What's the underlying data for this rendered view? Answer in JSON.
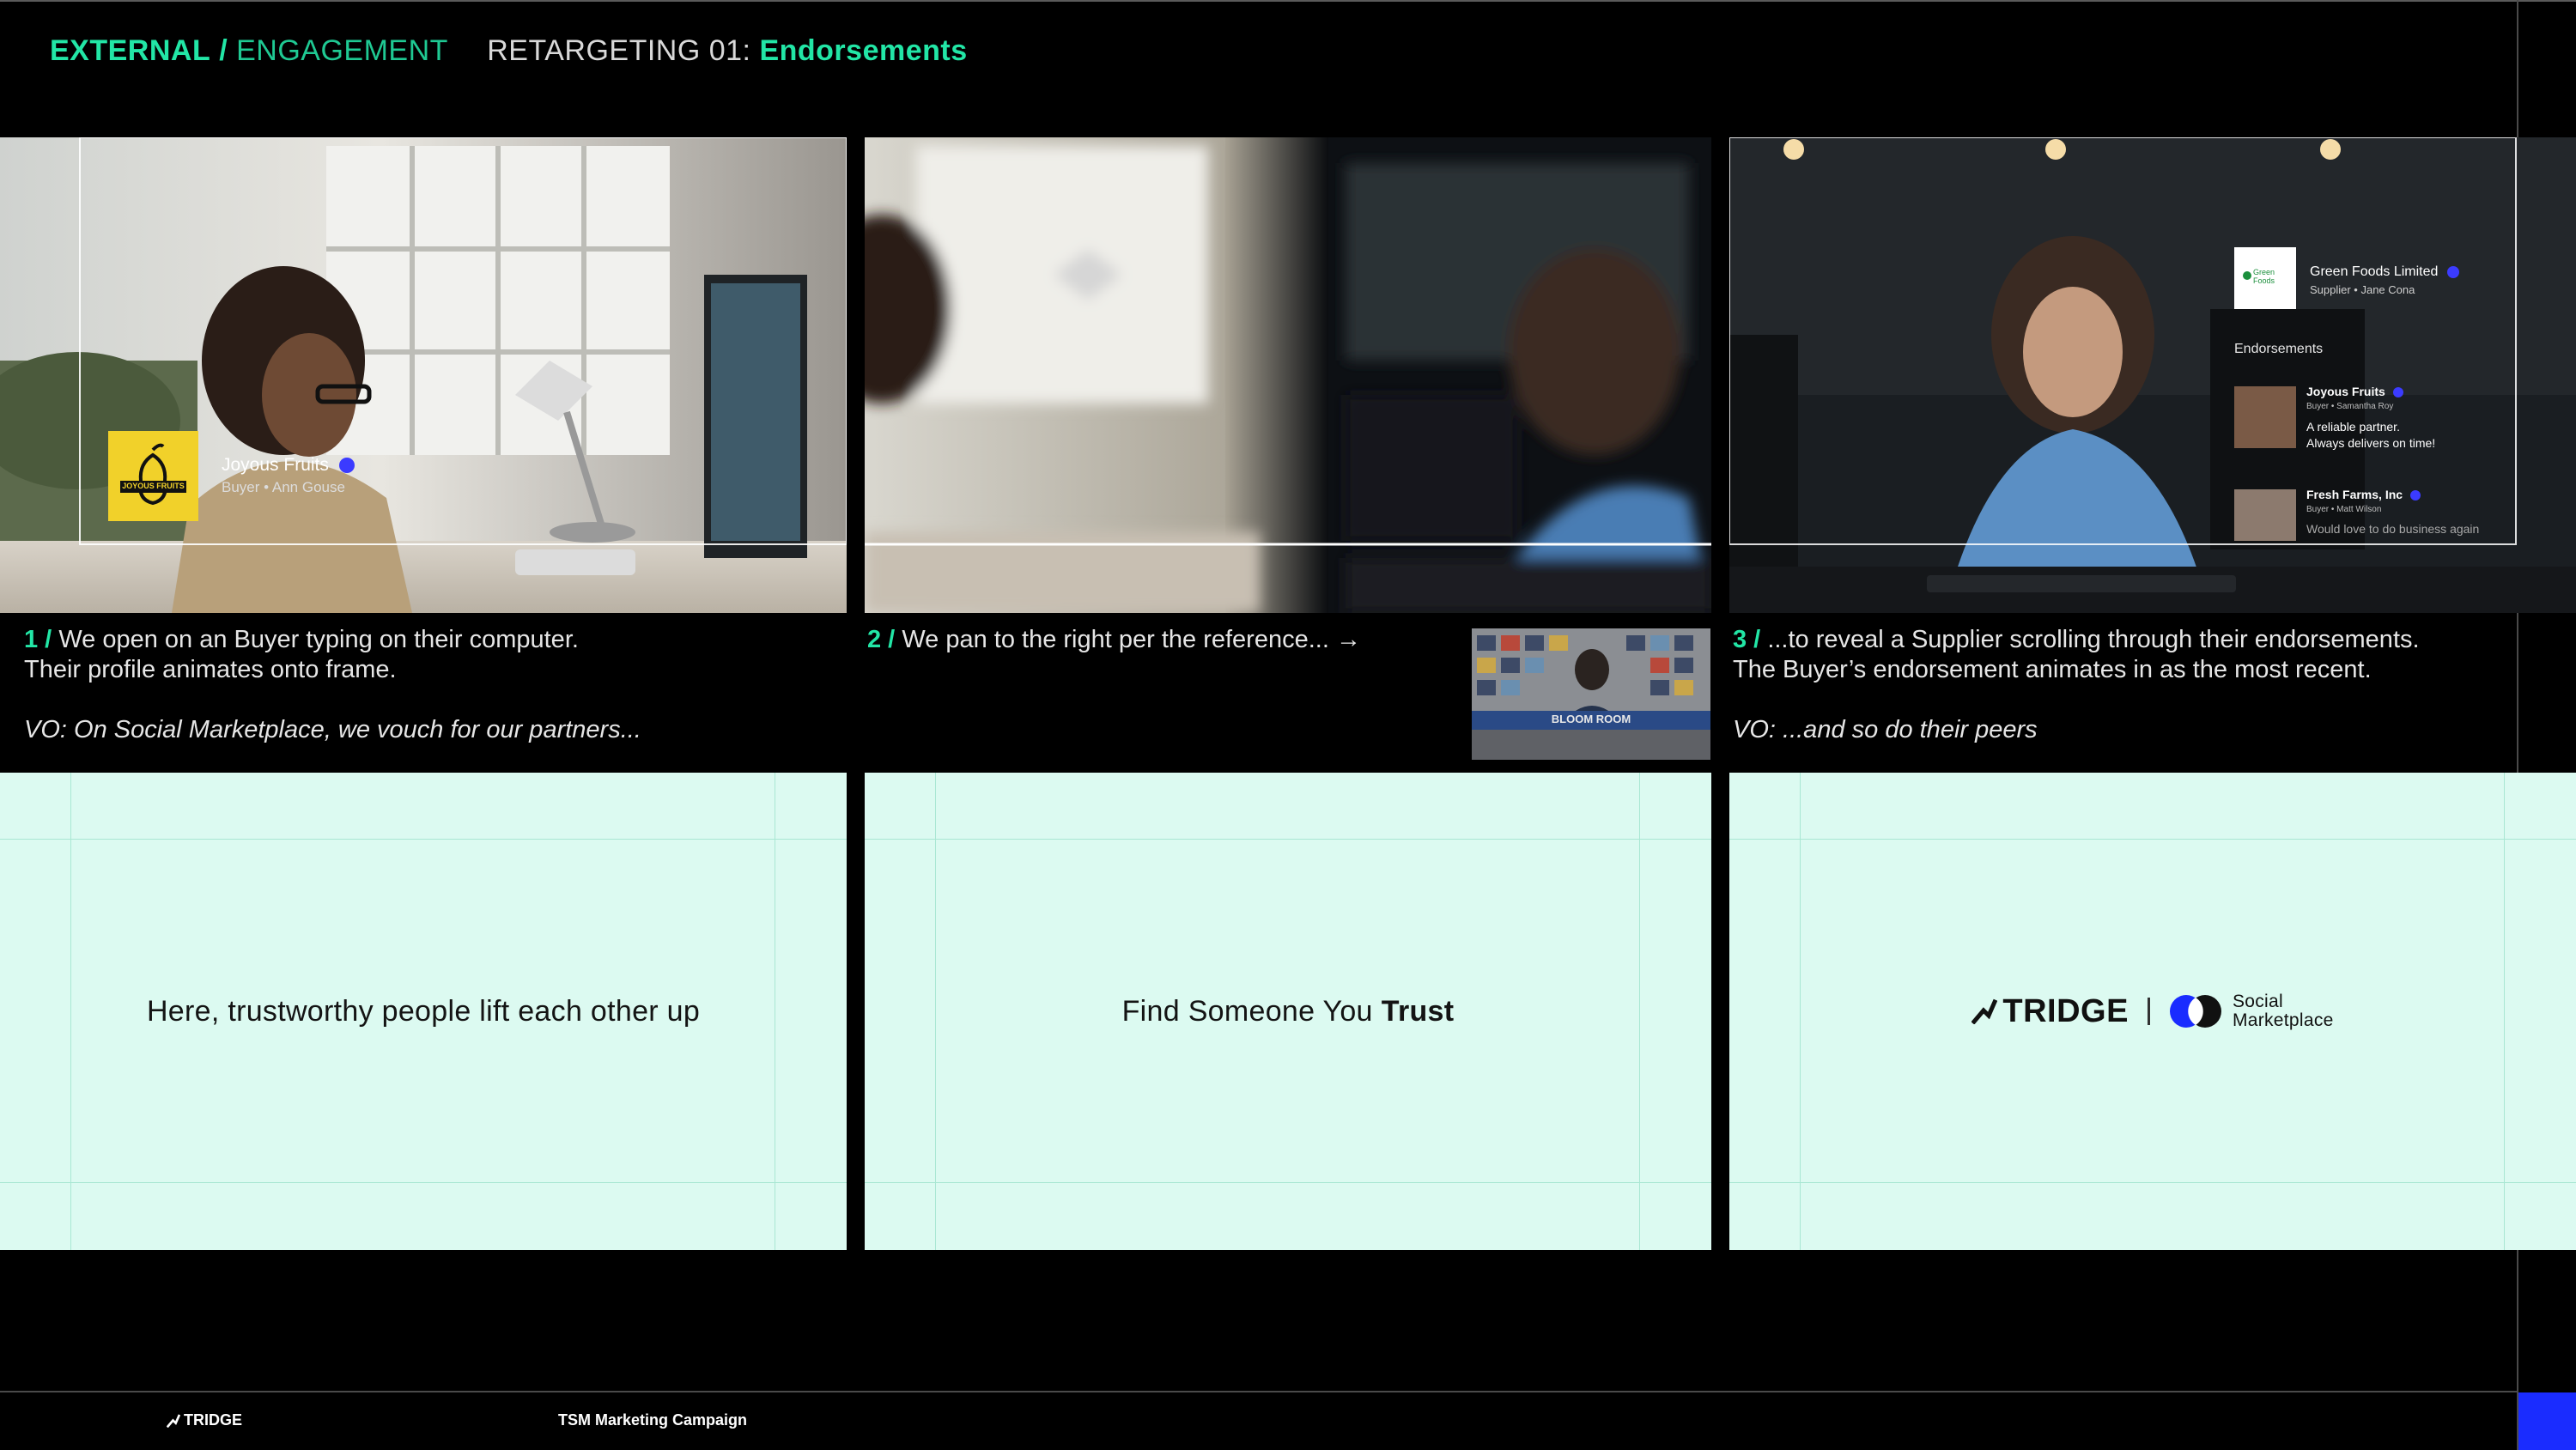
{
  "header": {
    "section": "EXTERNAL",
    "separator": "/",
    "subsection": "ENGAGEMENT",
    "title_prefix": "RETARGETING 01:",
    "title_highlight": "Endorsements"
  },
  "frames": {
    "f1": {
      "profile_name": "Joyous Fruits",
      "profile_sub": "Buyer • Ann Gouse",
      "logo_text": "JOYOUS FRUITS"
    },
    "f3": {
      "supplier_name": "Green Foods Limited",
      "supplier_sub": "Supplier • Jane Cona",
      "supplier_logo_text": "Green Foods",
      "endorsements_label": "Endorsements",
      "e1_name": "Joyous Fruits",
      "e1_sub": "Buyer • Samantha Roy",
      "e1_quote_1": "A reliable partner.",
      "e1_quote_2": "Always delivers on time!",
      "e2_name": "Fresh Farms, Inc",
      "e2_sub": "Buyer • Matt Wilson",
      "e2_quote": "Would love to do business again"
    }
  },
  "captions": {
    "c1": {
      "num": "1 /",
      "line1": "We open on an Buyer typing on their computer.",
      "line2": "Their profile animates onto frame.",
      "vo": "VO: On Social Marketplace, we vouch for our partners..."
    },
    "c2": {
      "num": "2 /",
      "line1": "We pan to the right per the reference... →"
    },
    "c3": {
      "num": "3 /",
      "line1": "...to reveal a Supplier scrolling through their endorsements.",
      "line2": "The Buyer’s endorsement animates in as the most recent.",
      "vo": "VO: ...and so do their peers"
    }
  },
  "reference_thumb": {
    "sign": "BLOOM ROOM"
  },
  "cards": {
    "card1": {
      "text": "Here, trustworthy people lift each other up"
    },
    "card2": {
      "text": "Find Someone You",
      "bold": "Trust"
    },
    "card3": {
      "brand": "TRIDGE",
      "sm_line1": "Social",
      "sm_line2": "Marketplace"
    }
  },
  "footer": {
    "logo": "TRIDGE",
    "title": "TSM Marketing Campaign"
  },
  "colors": {
    "accent": "#22e6a6",
    "card_bg": "#dcfaf1",
    "blue": "#1a2cff",
    "verified": "#3b3bff"
  }
}
